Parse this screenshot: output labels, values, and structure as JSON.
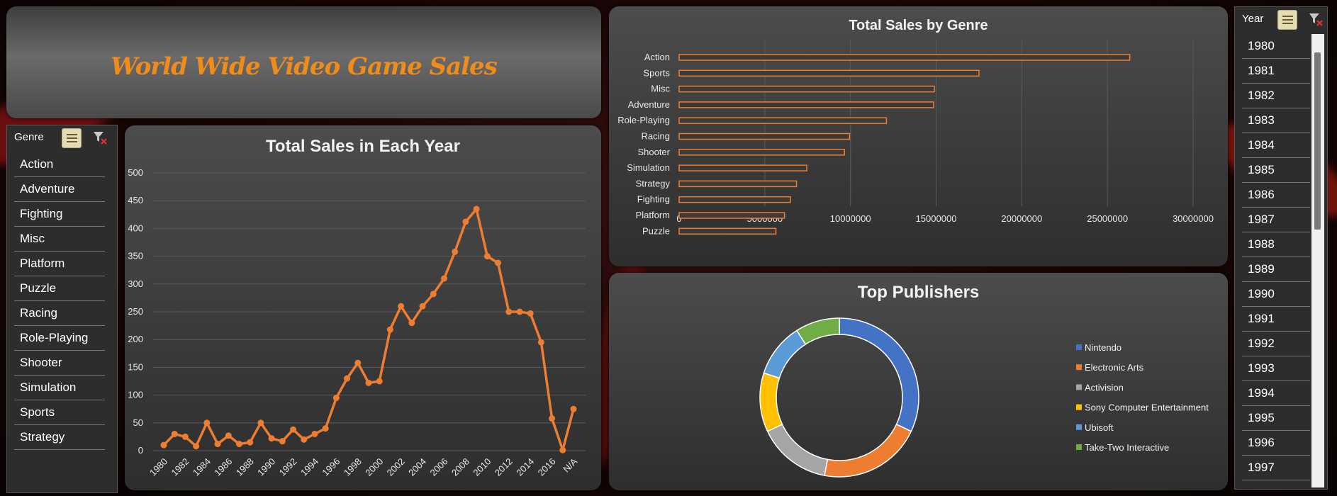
{
  "dashboard_title": "World Wide Video Game Sales",
  "genre_slicer": {
    "header": "Genre",
    "items": [
      "Action",
      "Adventure",
      "Fighting",
      "Misc",
      "Platform",
      "Puzzle",
      "Racing",
      "Role-Playing",
      "Shooter",
      "Simulation",
      "Sports",
      "Strategy"
    ]
  },
  "year_slicer": {
    "header": "Year",
    "items": [
      "1980",
      "1981",
      "1982",
      "1983",
      "1984",
      "1985",
      "1986",
      "1987",
      "1988",
      "1989",
      "1990",
      "1991",
      "1992",
      "1993",
      "1994",
      "1995",
      "1996",
      "1997"
    ]
  },
  "colors": {
    "accent": "#f08c1a",
    "line": "#ed7d31",
    "bar_edge": "#ed7d31"
  },
  "chart_data": [
    {
      "type": "line",
      "title": "Total Sales in Each Year",
      "x": [
        "1980",
        "1981",
        "1982",
        "1983",
        "1984",
        "1985",
        "1986",
        "1987",
        "1988",
        "1989",
        "1990",
        "1991",
        "1992",
        "1993",
        "1994",
        "1995",
        "1996",
        "1997",
        "1998",
        "1999",
        "2000",
        "2001",
        "2002",
        "2003",
        "2004",
        "2005",
        "2006",
        "2007",
        "2008",
        "2009",
        "2010",
        "2011",
        "2012",
        "2013",
        "2014",
        "2015",
        "2016",
        "2017",
        "N/A"
      ],
      "x_tick_labels": [
        "1980",
        "1982",
        "1984",
        "1986",
        "1988",
        "1990",
        "1992",
        "1994",
        "1996",
        "1998",
        "2000",
        "2002",
        "2004",
        "2006",
        "2008",
        "2010",
        "2012",
        "2014",
        "2016",
        "N/A"
      ],
      "values": [
        10,
        30,
        25,
        8,
        50,
        12,
        27,
        12,
        15,
        50,
        22,
        17,
        38,
        20,
        30,
        40,
        95,
        130,
        158,
        122,
        125,
        218,
        260,
        230,
        260,
        282,
        310,
        358,
        412,
        435,
        350,
        338,
        250,
        250,
        247,
        195,
        58,
        1,
        75
      ],
      "ylim": [
        0,
        500
      ],
      "yticks": [
        0,
        50,
        100,
        150,
        200,
        250,
        300,
        350,
        400,
        450,
        500
      ],
      "grid": true
    },
    {
      "type": "bar",
      "orientation": "horizontal",
      "title": "Total Sales by Genre",
      "categories": [
        "Action",
        "Sports",
        "Misc",
        "Adventure",
        "Role-Playing",
        "Racing",
        "Shooter",
        "Simulation",
        "Strategy",
        "Fighting",
        "Platform",
        "Puzzle"
      ],
      "values": [
        26300000,
        17500000,
        14900000,
        14850000,
        12100000,
        9950000,
        9650000,
        7450000,
        6850000,
        6500000,
        6150000,
        5650000
      ],
      "xlim": [
        0,
        30000000
      ],
      "xticks": [
        "0",
        "5000000",
        "10000000",
        "15000000",
        "20000000",
        "25000000",
        "30000000"
      ],
      "grid": true
    },
    {
      "type": "pie",
      "title": "Top Publishers",
      "series": [
        {
          "name": "Nintendo",
          "value": 32,
          "color": "#4472c4"
        },
        {
          "name": "Electronic Arts",
          "value": 21,
          "color": "#ed7d31"
        },
        {
          "name": "Activision",
          "value": 15,
          "color": "#a5a5a5"
        },
        {
          "name": "Sony Computer Entertainment",
          "value": 12,
          "color": "#ffc000"
        },
        {
          "name": "Ubisoft",
          "value": 11,
          "color": "#5b9bd5"
        },
        {
          "name": "Take-Two Interactive",
          "value": 9,
          "color": "#70ad47"
        }
      ],
      "legend": "right"
    }
  ]
}
